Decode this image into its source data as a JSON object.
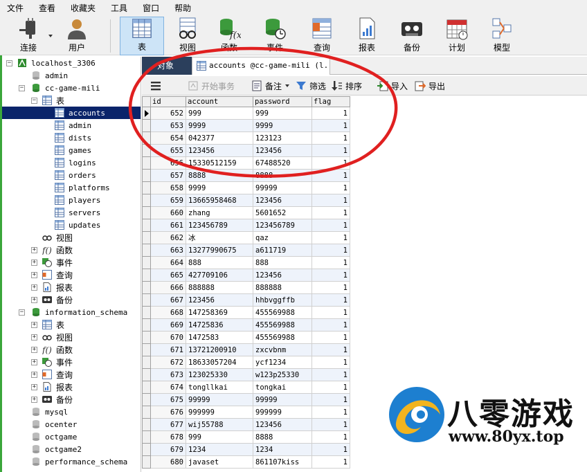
{
  "menu": [
    "文件",
    "查看",
    "收藏夹",
    "工具",
    "窗口",
    "帮助"
  ],
  "toolbar": {
    "connect": "连接",
    "user": "用户",
    "table": "表",
    "view": "视图",
    "function": "函数",
    "event": "事件",
    "query": "查询",
    "report": "报表",
    "backup": "备份",
    "schedule": "计划",
    "model": "模型"
  },
  "tree": {
    "connection": "localhost_3306",
    "db_admin": "admin",
    "db_game": "cc-game-mili",
    "node_tables": "表",
    "tables": [
      "accounts",
      "admin",
      "dists",
      "games",
      "logins",
      "orders",
      "platforms",
      "players",
      "servers",
      "updates"
    ],
    "node_views": "视图",
    "node_functions": "函数",
    "node_events": "事件",
    "node_queries": "查询",
    "node_reports": "报表",
    "node_backups": "备份",
    "db_info": "information_schema",
    "info_tables": "表",
    "info_views": "视图",
    "info_functions": "函数",
    "info_events": "事件",
    "info_queries": "查询",
    "info_reports": "报表",
    "info_backups": "备份",
    "db_mysql": "mysql",
    "db_ocenter": "ocenter",
    "db_octgame": "octgame",
    "db_octgame2": "octgame2",
    "db_perf": "performance_schema"
  },
  "tabs": {
    "objects": "对象",
    "accounts": "accounts @cc-game-mili (l..."
  },
  "subtoolbar": {
    "begin_transaction": "开始事务",
    "memo": "备注",
    "filter": "筛选",
    "sort": "排序",
    "import": "导入",
    "export": "导出"
  },
  "grid": {
    "columns": [
      "id",
      "account",
      "password",
      "flag"
    ],
    "rows": [
      [
        "652",
        "999",
        "999",
        "1"
      ],
      [
        "653",
        "9999",
        "9999",
        "1"
      ],
      [
        "654",
        "042377",
        "123123",
        "1"
      ],
      [
        "655",
        "123456",
        "123456",
        "1"
      ],
      [
        "656",
        "15330512159",
        "67488520",
        "1"
      ],
      [
        "657",
        "8888",
        "8888",
        "1"
      ],
      [
        "658",
        "9999",
        "99999",
        "1"
      ],
      [
        "659",
        "13665958468",
        "123456",
        "1"
      ],
      [
        "660",
        "zhang",
        "5601652",
        "1"
      ],
      [
        "661",
        "123456789",
        "123456789",
        "1"
      ],
      [
        "662",
        "冰",
        "qaz",
        "1"
      ],
      [
        "663",
        "13277990675",
        "a611719",
        "1"
      ],
      [
        "664",
        "888",
        "888",
        "1"
      ],
      [
        "665",
        "427709106",
        "123456",
        "1"
      ],
      [
        "666",
        "888888",
        "888888",
        "1"
      ],
      [
        "667",
        "123456",
        "hhbvggffb",
        "1"
      ],
      [
        "668",
        "147258369",
        "455569988",
        "1"
      ],
      [
        "669",
        "14725836",
        "455569988",
        "1"
      ],
      [
        "670",
        "1472583",
        "455569988",
        "1"
      ],
      [
        "671",
        "13721200910",
        "zxcvbnm",
        "1"
      ],
      [
        "672",
        "18633057204",
        "ycf1234",
        "1"
      ],
      [
        "673",
        "123025330",
        "w123p25330",
        "1"
      ],
      [
        "674",
        "tongllkai",
        "tongkai",
        "1"
      ],
      [
        "675",
        "99999",
        "99999",
        "1"
      ],
      [
        "676",
        "999999",
        "999999",
        "1"
      ],
      [
        "677",
        "wij55788",
        "123456",
        "1"
      ],
      [
        "678",
        "999",
        "8888",
        "1"
      ],
      [
        "679",
        "1234",
        "1234",
        "1"
      ],
      [
        "680",
        "javaset",
        "861107kiss",
        "1"
      ]
    ]
  },
  "watermark": {
    "title": "八零游戏",
    "url": "www.80yx.top"
  },
  "colors": {
    "selection": "#0a246a",
    "annotation": "#e02020",
    "tab_dark": "#2b3f5c",
    "active_tool": "#cde4f7"
  }
}
